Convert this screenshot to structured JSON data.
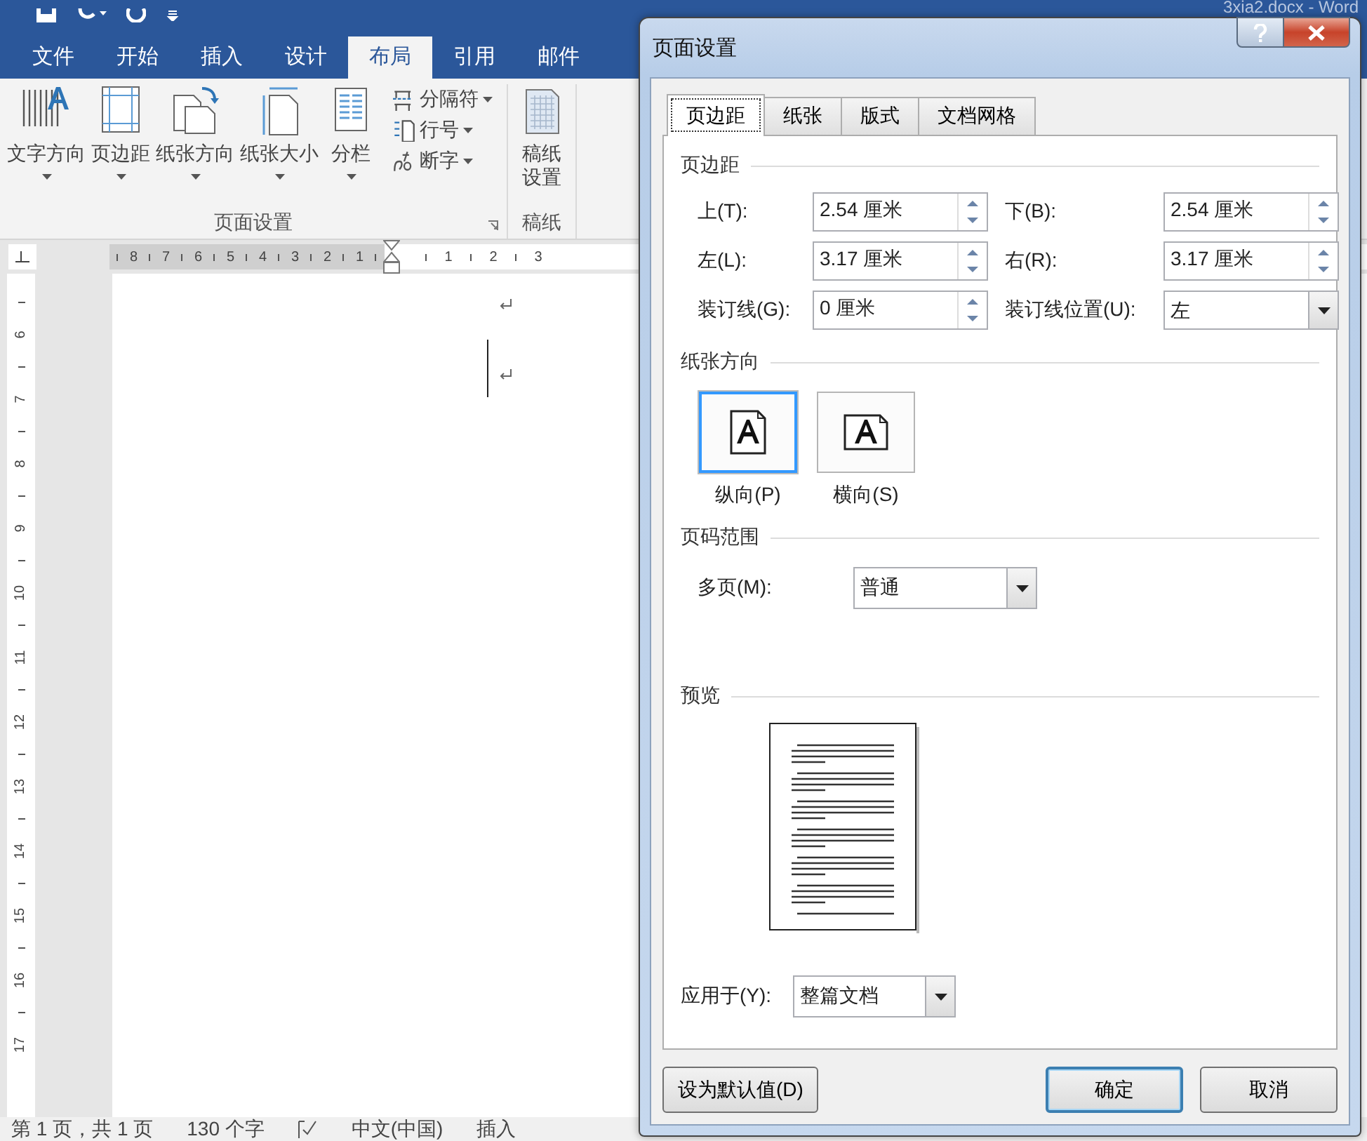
{
  "word": {
    "title": "3xia2.docx - Word",
    "tabs": [
      {
        "label": "文件",
        "selected": false
      },
      {
        "label": "开始",
        "selected": false
      },
      {
        "label": "插入",
        "selected": false
      },
      {
        "label": "设计",
        "selected": false
      },
      {
        "label": "布局",
        "selected": true
      },
      {
        "label": "引用",
        "selected": false
      },
      {
        "label": "邮件",
        "selected": false
      }
    ],
    "ribbon": {
      "groups": [
        {
          "label": "页面设置",
          "large_buttons": [
            {
              "label": "文字方向",
              "dropdown": true
            },
            {
              "label": "页边距",
              "dropdown": true
            },
            {
              "label": "纸张方向",
              "dropdown": true
            },
            {
              "label": "纸张大小",
              "dropdown": true
            },
            {
              "label": "分栏",
              "dropdown": true
            }
          ],
          "small_buttons": [
            "分隔符",
            "行号",
            "断字"
          ]
        },
        {
          "label": "稿纸",
          "large_buttons": [
            {
              "label": "稿纸设置",
              "dropdown": false
            }
          ]
        }
      ]
    },
    "ruler": {
      "left_numbers": [
        "8",
        "7",
        "6",
        "5",
        "4",
        "3",
        "2",
        "1"
      ],
      "right_numbers": [
        "1",
        "2",
        "3"
      ]
    },
    "vertical_ruler": [
      "6",
      "7",
      "8",
      "9",
      "10",
      "11",
      "12",
      "13",
      "14",
      "15",
      "16",
      "17"
    ],
    "status_bar": [
      "第 1 页，共 1 页",
      "130 个字",
      "中文(中国)",
      "插入"
    ]
  },
  "dialog": {
    "title": "页面设置",
    "tabs": [
      {
        "label": "页边距",
        "selected": true
      },
      {
        "label": "纸张",
        "selected": false
      },
      {
        "label": "版式",
        "selected": false
      },
      {
        "label": "文档网格",
        "selected": false
      }
    ],
    "margins": {
      "heading": "页边距",
      "fields": [
        {
          "label": "上(T):",
          "value": "2.54 厘米",
          "kind": "spinner"
        },
        {
          "label": "下(B):",
          "value": "2.54 厘米",
          "kind": "spinner"
        },
        {
          "label": "左(L):",
          "value": "3.17 厘米",
          "kind": "spinner"
        },
        {
          "label": "右(R):",
          "value": "3.17 厘米",
          "kind": "spinner"
        },
        {
          "label": "装订线(G):",
          "value": "0 厘米",
          "kind": "spinner"
        },
        {
          "label": "装订线位置(U):",
          "value": "左",
          "kind": "dropdown"
        }
      ]
    },
    "orientation": {
      "heading": "纸张方向",
      "options": [
        {
          "label": "纵向(P)",
          "selected": true
        },
        {
          "label": "横向(S)",
          "selected": false
        }
      ]
    },
    "pages": {
      "heading": "页码范围",
      "label": "多页(M):",
      "value": "普通"
    },
    "preview": {
      "heading": "预览",
      "apply_label": "应用于(Y):",
      "apply_value": "整篇文档"
    },
    "buttons": [
      {
        "label": "设为默认值(D)",
        "default": false
      },
      {
        "label": "确定",
        "default": true
      },
      {
        "label": "取消",
        "default": false
      }
    ]
  }
}
